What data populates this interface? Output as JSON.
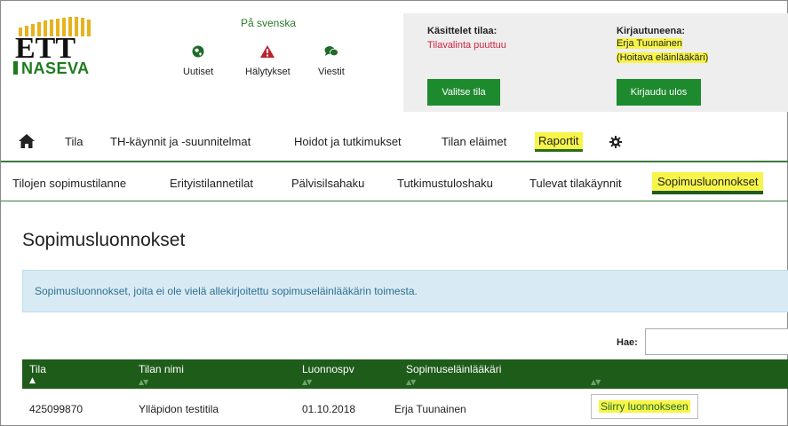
{
  "header": {
    "logo": {
      "top_text": "ETT",
      "bottom_text": "NASEVA"
    },
    "language_link": "På svenska",
    "icons": [
      {
        "icon": "globe-icon",
        "label": "Uutiset"
      },
      {
        "icon": "warning-icon",
        "label": "Hälytykset"
      },
      {
        "icon": "chat-icon",
        "label": "Viestit"
      }
    ]
  },
  "status_panel": {
    "farm": {
      "title": "Käsittelet tilaa:",
      "value": "Tilavalinta puuttuu",
      "button": "Valitse tila"
    },
    "user": {
      "title": "Kirjautuneena:",
      "name": "Erja Tuunainen",
      "role": "(Hoitava eläinlääkäri)",
      "button": "Kirjaudu ulos"
    }
  },
  "main_nav": {
    "home_icon": "home-icon",
    "items": [
      "Tila",
      "TH-käynnit ja -suunnitelmat",
      "Hoidot ja tutkimukset",
      "Tilan eläimet",
      "Raportit"
    ],
    "active": "Raportit",
    "settings_icon": "gear-icon"
  },
  "sub_nav": {
    "items": [
      "Tilojen sopimustilanne",
      "Erityistilannetilat",
      "Pälvisilsahaku",
      "Tutkimustuloshaku",
      "Tulevat tilakäynnit",
      "Sopimusluonnokset"
    ],
    "active": "Sopimusluonnokset"
  },
  "page": {
    "title": "Sopimusluonnokset",
    "info": "Sopimusluonnokset, joita ei ole vielä allekirjoitettu sopimuseläinlääkärin toimesta.",
    "search_label": "Hae:",
    "search_value": ""
  },
  "table": {
    "columns": [
      "Tila",
      "Tilan nimi",
      "Luonnospv",
      "Sopimuseläinlääkäri",
      ""
    ],
    "sort_indicator": "▲",
    "sort_neutral": "▲▼",
    "rows": [
      {
        "tila": "425099870",
        "nimi": "Ylläpidon testitila",
        "pvm": "01.10.2018",
        "laakari": "Erja Tuunainen",
        "action": "Siirry luonnokseen"
      }
    ]
  },
  "colors": {
    "green": "#1e8a2e",
    "dark_green": "#1e5c1a",
    "highlight": "#f7f44a",
    "info_bg": "#d8ebf4",
    "alert_red": "#d0243f"
  }
}
